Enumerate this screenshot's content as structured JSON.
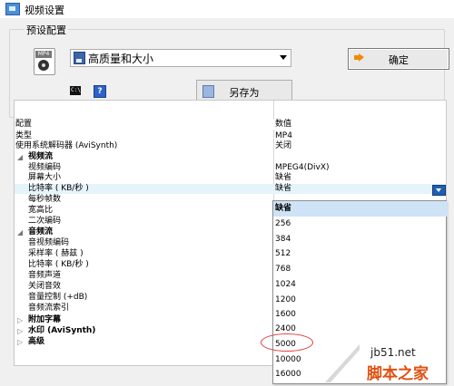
{
  "window": {
    "title": "视频设置"
  },
  "preset": {
    "group_label": "预设配置",
    "icon_text": "MP4",
    "selected": "高质量和大小",
    "ok_label": "确定",
    "save_as_label": "另存为"
  },
  "grid": {
    "header": {
      "key": "配置",
      "value": "数值"
    },
    "rows": [
      {
        "key": "类型",
        "value": "MP4"
      },
      {
        "key": "使用系统解码器 (AviSynth)",
        "value": "关闭"
      },
      {
        "key": "视频流",
        "value": ""
      },
      {
        "key": "视频编码",
        "value": "MPEG4(DivX)"
      },
      {
        "key": "屏幕大小",
        "value": "缺省"
      },
      {
        "key": "比特率 ( KB/秒 )",
        "value": "缺省"
      },
      {
        "key": "每秒帧数",
        "value": ""
      },
      {
        "key": "宽高比",
        "value": ""
      },
      {
        "key": "二次编码",
        "value": ""
      },
      {
        "key": "音频流",
        "value": ""
      },
      {
        "key": "音视频编码",
        "value": ""
      },
      {
        "key": "采样率 ( 赫兹 )",
        "value": ""
      },
      {
        "key": "比特率 ( KB/秒 )",
        "value": ""
      },
      {
        "key": "音频声道",
        "value": ""
      },
      {
        "key": "关闭音效",
        "value": ""
      },
      {
        "key": "音量控制 (+dB)",
        "value": ""
      },
      {
        "key": "音频流索引",
        "value": ""
      },
      {
        "key": "附加字幕",
        "value": ""
      },
      {
        "key": "水印 (AviSynth)",
        "value": ""
      },
      {
        "key": "高级",
        "value": ""
      }
    ]
  },
  "dropdown": {
    "options": [
      "缺省",
      "256",
      "384",
      "512",
      "768",
      "1024",
      "1200",
      "1600",
      "2400",
      "5000",
      "10000",
      "16000"
    ]
  },
  "watermark": {
    "site": "jb51.net",
    "name": "脚本之家"
  },
  "colors": {
    "selection": "#cfe3f6",
    "highlight_circle": "#e04040",
    "watermark_orange": "#e05010"
  }
}
